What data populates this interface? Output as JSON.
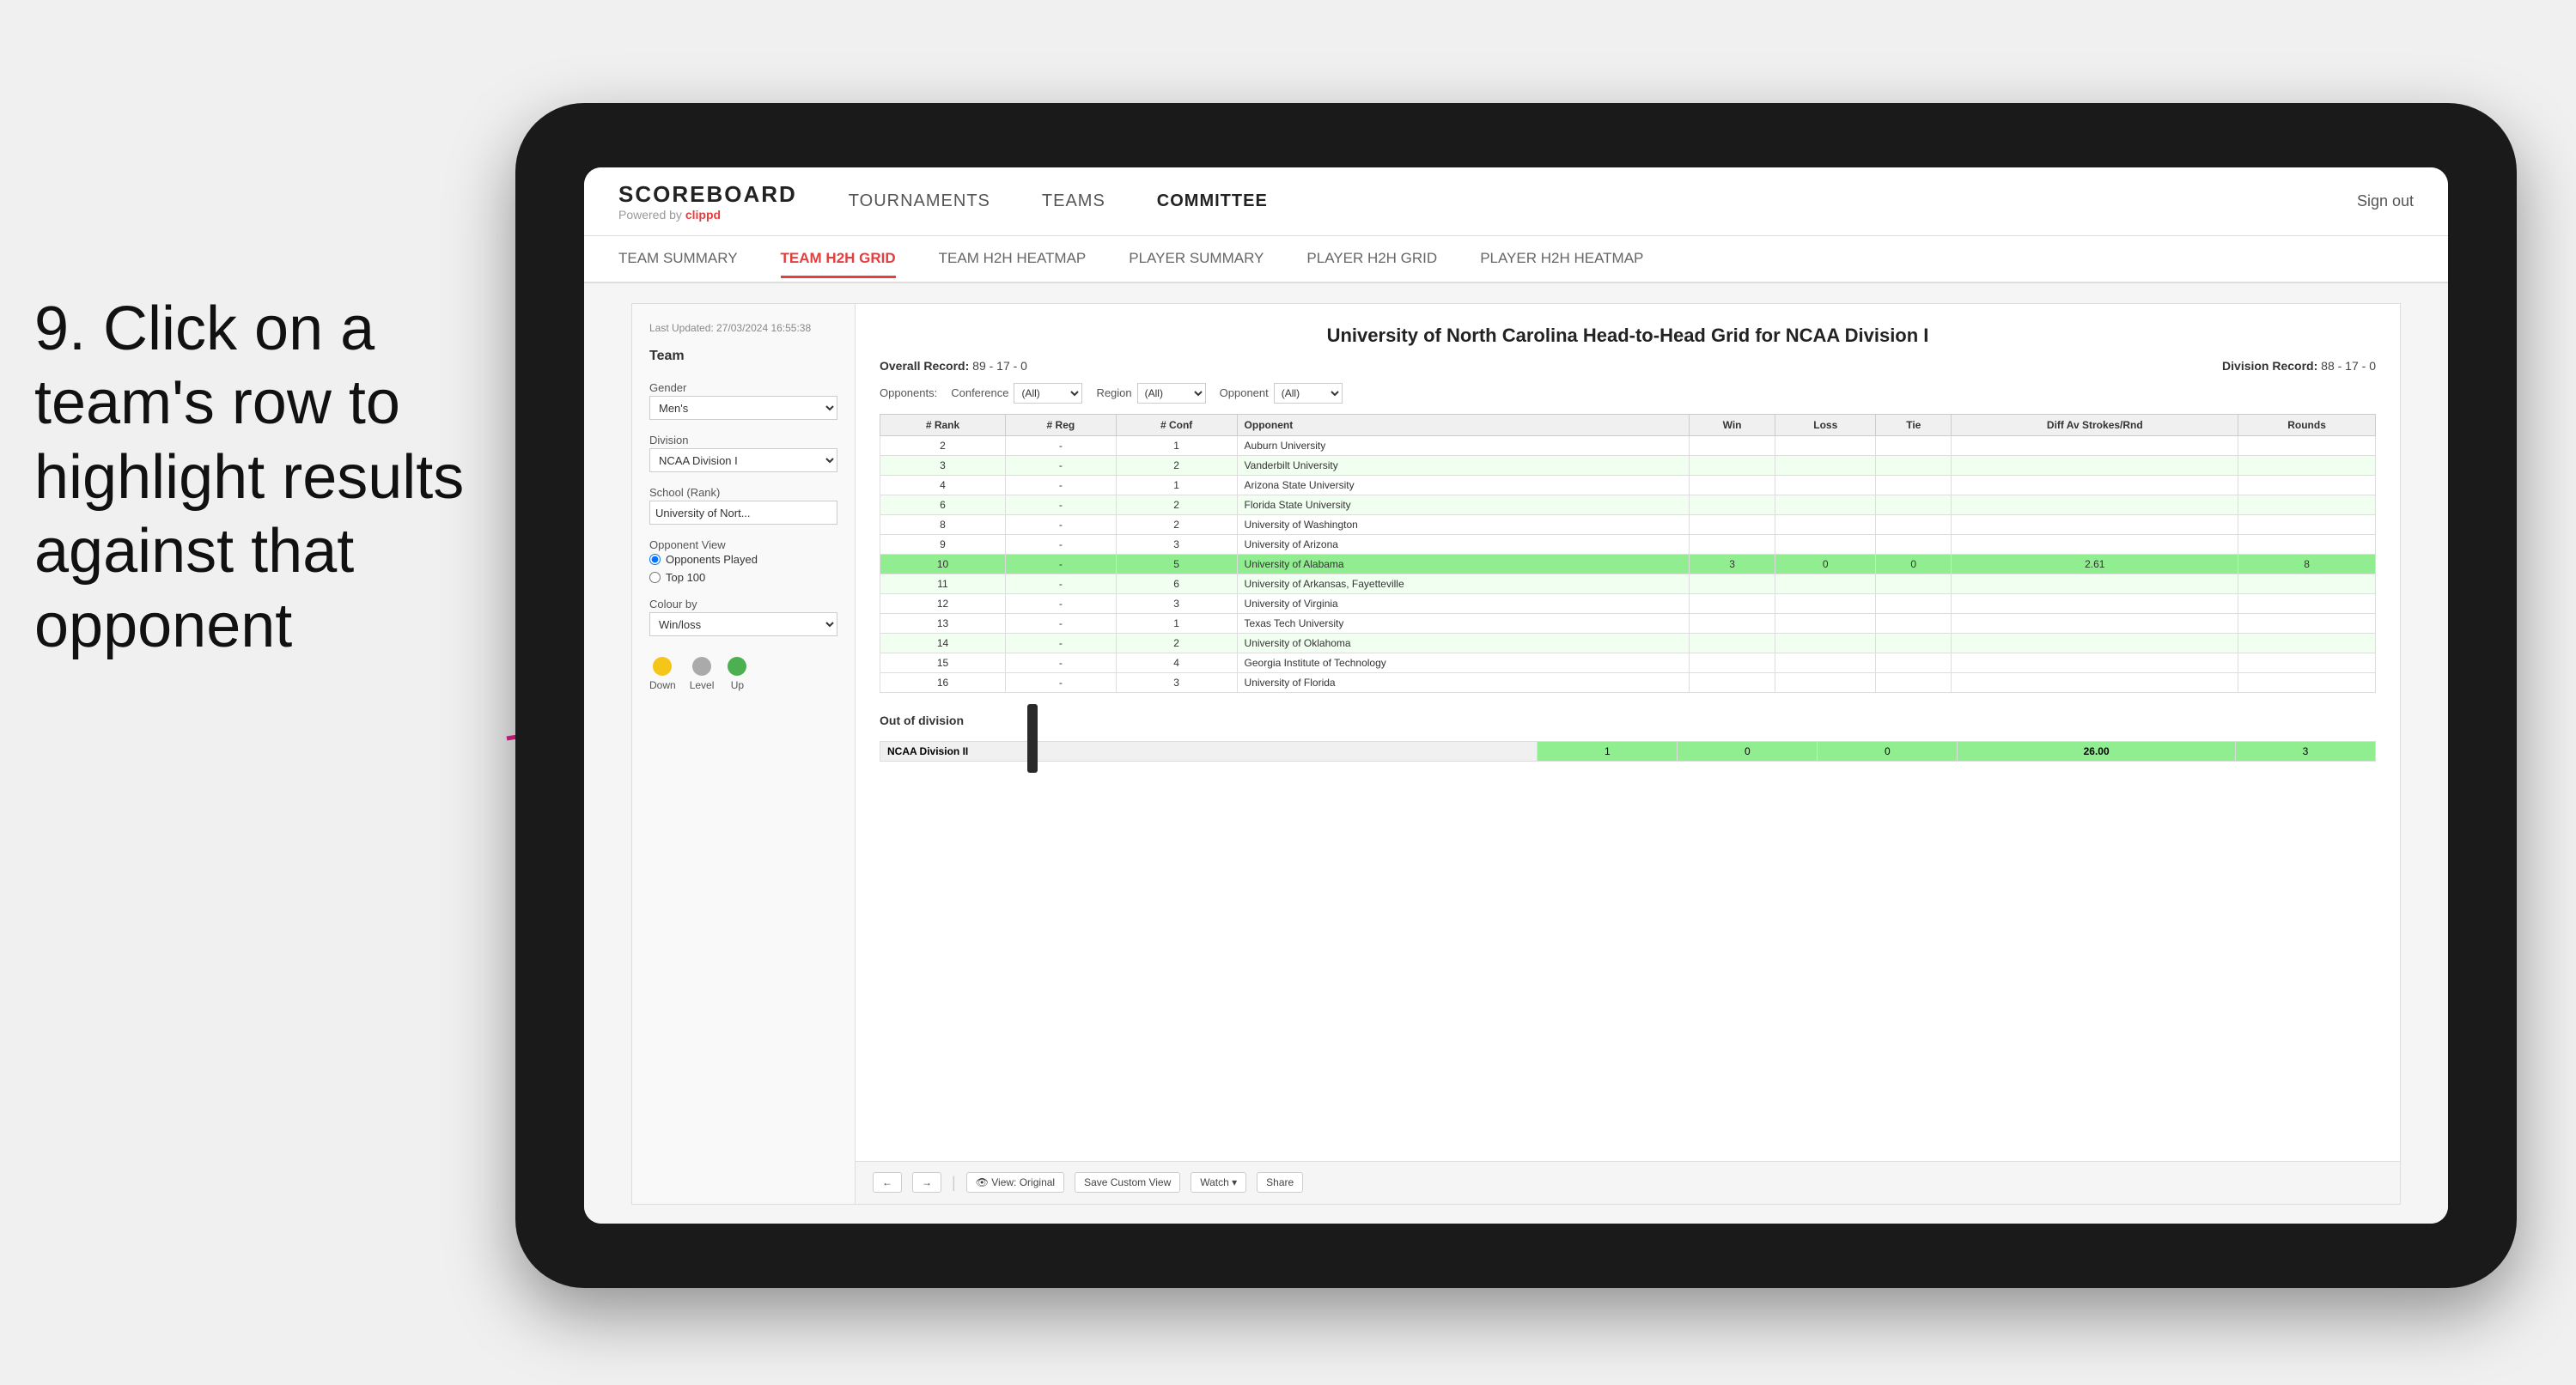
{
  "annotation": {
    "text": "9. Click on a team's row to highlight results against that opponent"
  },
  "navbar": {
    "logo": {
      "scoreboard": "SCOREBOARD",
      "powered_by": "Powered by",
      "brand": "clippd"
    },
    "items": [
      {
        "label": "TOURNAMENTS",
        "active": false
      },
      {
        "label": "TEAMS",
        "active": false
      },
      {
        "label": "COMMITTEE",
        "active": true
      }
    ],
    "sign_out": "Sign out"
  },
  "subnav": {
    "items": [
      {
        "label": "TEAM SUMMARY",
        "active": false
      },
      {
        "label": "TEAM H2H GRID",
        "active": true
      },
      {
        "label": "TEAM H2H HEATMAP",
        "active": false
      },
      {
        "label": "PLAYER SUMMARY",
        "active": false
      },
      {
        "label": "PLAYER H2H GRID",
        "active": false
      },
      {
        "label": "PLAYER H2H HEATMAP",
        "active": false
      }
    ]
  },
  "sidebar": {
    "timestamp": "Last Updated: 27/03/2024\n16:55:38",
    "team_label": "Team",
    "gender_label": "Gender",
    "gender_value": "Men's",
    "division_label": "Division",
    "division_value": "NCAA Division I",
    "school_label": "School (Rank)",
    "school_value": "University of Nort...",
    "opponent_view_label": "Opponent View",
    "radio_opponents": "Opponents Played",
    "radio_top100": "Top 100",
    "colour_by_label": "Colour by",
    "colour_by_value": "Win/loss",
    "legend": [
      {
        "label": "Down",
        "color": "#f5c518"
      },
      {
        "label": "Level",
        "color": "#aaaaaa"
      },
      {
        "label": "Up",
        "color": "#4caf50"
      }
    ]
  },
  "content": {
    "title": "University of North Carolina Head-to-Head Grid for NCAA Division I",
    "overall_record_label": "Overall Record:",
    "overall_record_value": "89 - 17 - 0",
    "division_record_label": "Division Record:",
    "division_record_value": "88 - 17 - 0",
    "filters": {
      "opponents_label": "Opponents:",
      "opponents_value": "(All)",
      "conference_label": "Conference",
      "conference_value": "(All)",
      "region_label": "Region",
      "region_value": "(All)",
      "opponent_label": "Opponent",
      "opponent_value": "(All)"
    },
    "table_headers": [
      "# Rank",
      "# Reg",
      "# Conf",
      "Opponent",
      "Win",
      "Loss",
      "Tie",
      "Diff Av Strokes/Rnd",
      "Rounds"
    ],
    "rows": [
      {
        "rank": "2",
        "reg": "-",
        "conf": "1",
        "opponent": "Auburn University",
        "win": "",
        "loss": "",
        "tie": "",
        "diff": "",
        "rounds": "",
        "style": "normal"
      },
      {
        "rank": "3",
        "reg": "-",
        "conf": "2",
        "opponent": "Vanderbilt University",
        "win": "",
        "loss": "",
        "tie": "",
        "diff": "",
        "rounds": "",
        "style": "light-green"
      },
      {
        "rank": "4",
        "reg": "-",
        "conf": "1",
        "opponent": "Arizona State University",
        "win": "",
        "loss": "",
        "tie": "",
        "diff": "",
        "rounds": "",
        "style": "normal"
      },
      {
        "rank": "6",
        "reg": "-",
        "conf": "2",
        "opponent": "Florida State University",
        "win": "",
        "loss": "",
        "tie": "",
        "diff": "",
        "rounds": "",
        "style": "light-green"
      },
      {
        "rank": "8",
        "reg": "-",
        "conf": "2",
        "opponent": "University of Washington",
        "win": "",
        "loss": "",
        "tie": "",
        "diff": "",
        "rounds": "",
        "style": "normal"
      },
      {
        "rank": "9",
        "reg": "-",
        "conf": "3",
        "opponent": "University of Arizona",
        "win": "",
        "loss": "",
        "tie": "",
        "diff": "",
        "rounds": "",
        "style": "normal"
      },
      {
        "rank": "10",
        "reg": "-",
        "conf": "5",
        "opponent": "University of Alabama",
        "win": "3",
        "loss": "0",
        "tie": "0",
        "diff": "2.61",
        "rounds": "8",
        "style": "highlighted"
      },
      {
        "rank": "11",
        "reg": "-",
        "conf": "6",
        "opponent": "University of Arkansas, Fayetteville",
        "win": "",
        "loss": "",
        "tie": "",
        "diff": "",
        "rounds": "",
        "style": "light-green"
      },
      {
        "rank": "12",
        "reg": "-",
        "conf": "3",
        "opponent": "University of Virginia",
        "win": "",
        "loss": "",
        "tie": "",
        "diff": "",
        "rounds": "",
        "style": "normal"
      },
      {
        "rank": "13",
        "reg": "-",
        "conf": "1",
        "opponent": "Texas Tech University",
        "win": "",
        "loss": "",
        "tie": "",
        "diff": "",
        "rounds": "",
        "style": "normal"
      },
      {
        "rank": "14",
        "reg": "-",
        "conf": "2",
        "opponent": "University of Oklahoma",
        "win": "",
        "loss": "",
        "tie": "",
        "diff": "",
        "rounds": "",
        "style": "light-green"
      },
      {
        "rank": "15",
        "reg": "-",
        "conf": "4",
        "opponent": "Georgia Institute of Technology",
        "win": "",
        "loss": "",
        "tie": "",
        "diff": "",
        "rounds": "",
        "style": "normal"
      },
      {
        "rank": "16",
        "reg": "-",
        "conf": "3",
        "opponent": "University of Florida",
        "win": "",
        "loss": "",
        "tie": "",
        "diff": "",
        "rounds": "",
        "style": "normal"
      }
    ],
    "out_of_division_label": "Out of division",
    "out_of_division_row": {
      "label": "NCAA Division II",
      "win": "1",
      "loss": "0",
      "tie": "0",
      "diff": "26.00",
      "rounds": "3"
    }
  },
  "toolbar": {
    "view_original": "View: Original",
    "save_custom": "Save Custom View",
    "watch": "Watch ▾",
    "share": "Share"
  }
}
